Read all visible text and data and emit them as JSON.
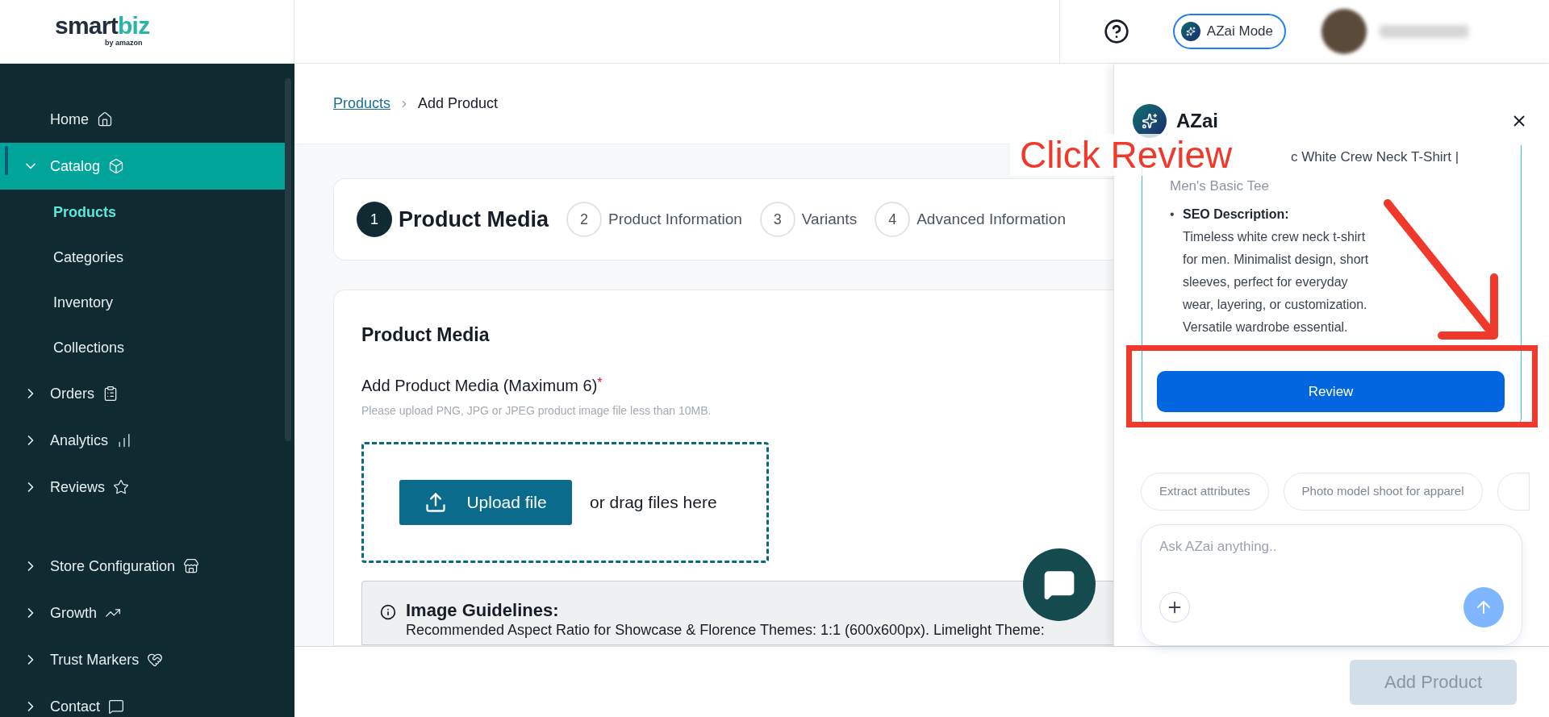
{
  "logo": {
    "text_1": "smart",
    "text_2": "biz",
    "tagline": "by amazon"
  },
  "header": {
    "mode_button": "AZai Mode"
  },
  "sidebar": {
    "items": [
      {
        "label": "Home",
        "kind": "link",
        "expanded": false,
        "selected": false
      },
      {
        "label": "Catalog",
        "kind": "group",
        "expanded": true,
        "selected": true,
        "children": [
          {
            "label": "Products",
            "selected": true
          },
          {
            "label": "Categories",
            "selected": false
          },
          {
            "label": "Inventory",
            "selected": false
          },
          {
            "label": "Collections",
            "selected": false
          }
        ]
      },
      {
        "label": "Orders",
        "kind": "group",
        "expanded": false,
        "selected": false
      },
      {
        "label": "Analytics",
        "kind": "group",
        "expanded": false,
        "selected": false
      },
      {
        "label": "Reviews",
        "kind": "group",
        "expanded": false,
        "selected": false
      }
    ],
    "items_2": [
      {
        "label": "Store Configuration",
        "kind": "group",
        "expanded": false,
        "selected": false
      },
      {
        "label": "Growth",
        "kind": "group",
        "expanded": false,
        "selected": false
      },
      {
        "label": "Trust Markers",
        "kind": "group",
        "expanded": false,
        "selected": false
      },
      {
        "label": "Contact",
        "kind": "group",
        "expanded": false,
        "selected": false
      }
    ]
  },
  "breadcrumb": {
    "link": "Products",
    "current": "Add Product"
  },
  "steps": [
    {
      "number": "1",
      "label": "Product Media",
      "selected": true
    },
    {
      "number": "2",
      "label": "Product Information",
      "selected": false
    },
    {
      "number": "3",
      "label": "Variants",
      "selected": false
    },
    {
      "number": "4",
      "label": "Advanced Information",
      "selected": false
    }
  ],
  "media_card": {
    "title": "Product Media",
    "field_label": "Add Product Media (Maximum 6)",
    "required_mark": "*",
    "hint": "Please upload PNG, JPG or JPEG product image file less than 10MB.",
    "upload_button": "Upload file",
    "drop_text": "or drag files here",
    "guidelines": {
      "title": "Image Guidelines:",
      "text": "Recommended Aspect Ratio for Showcase & Florence Themes: 1:1 (600x600px). Limelight Theme:"
    }
  },
  "footer": {
    "button": "Add Product",
    "disabled": true
  },
  "assistant": {
    "title": "AZai",
    "title_line": "c White Crew Neck T-Shirt |",
    "title_line_2": "Men's Basic Tee",
    "bullet": "•",
    "description_label": "SEO Description:",
    "description": "Timeless white crew neck t-shirt for men. Minimalist design, short sleeves, perfect for everyday wear, layering, or customization. Versatile wardrobe essential.",
    "review_button": "Review",
    "suggestions": [
      "Extract attributes",
      "Photo model shoot for apparel"
    ],
    "input": {
      "placeholder": "Ask AZai anything.."
    }
  },
  "annotation": {
    "label": "Click Review"
  }
}
